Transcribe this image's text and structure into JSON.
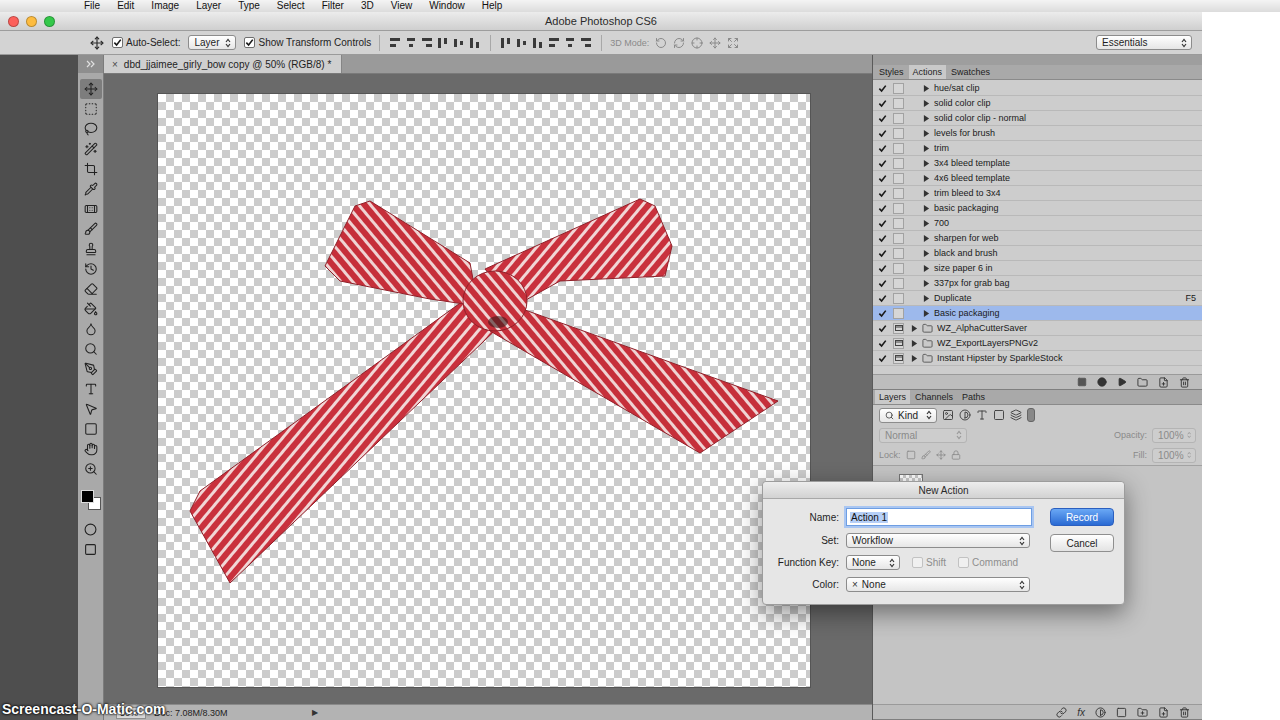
{
  "menu_bar": {
    "items": [
      "File",
      "Edit",
      "Image",
      "Layer",
      "Type",
      "Select",
      "Filter",
      "3D",
      "View",
      "Window",
      "Help"
    ]
  },
  "window": {
    "title": "Adobe Photoshop CS6"
  },
  "options_bar": {
    "auto_select": {
      "label": "Auto-Select:",
      "checked": true
    },
    "auto_select_target": "Layer",
    "transform_controls": {
      "label": "Show Transform Controls",
      "checked": true
    },
    "mode_3d_label": "3D Mode:",
    "workspace": "Essentials"
  },
  "document_tab": {
    "title": "dbd_jjaimee_girly_bow copy @ 50% (RGB/8) *",
    "close": "×",
    "selected": true
  },
  "actions_panel": {
    "tabs": [
      {
        "label": "Styles",
        "selected": false
      },
      {
        "label": "Actions",
        "selected": true
      },
      {
        "label": "Swatches",
        "selected": false
      }
    ],
    "items": [
      {
        "name": "hue/sat clip",
        "kind": "action",
        "enabled": true,
        "dialog": false,
        "expanded": false,
        "selected": false
      },
      {
        "name": "solid color clip",
        "kind": "action",
        "enabled": true,
        "dialog": false,
        "expanded": false,
        "selected": false
      },
      {
        "name": "solid color clip - normal",
        "kind": "action",
        "enabled": true,
        "dialog": false,
        "expanded": false,
        "selected": false
      },
      {
        "name": "levels for brush",
        "kind": "action",
        "enabled": true,
        "dialog": false,
        "expanded": false,
        "selected": false
      },
      {
        "name": "trim",
        "kind": "action",
        "enabled": true,
        "dialog": false,
        "expanded": false,
        "selected": false
      },
      {
        "name": "3x4 bleed template",
        "kind": "action",
        "enabled": true,
        "dialog": false,
        "expanded": false,
        "selected": false
      },
      {
        "name": "4x6 bleed template",
        "kind": "action",
        "enabled": true,
        "dialog": false,
        "expanded": false,
        "selected": false
      },
      {
        "name": "trim bleed to 3x4",
        "kind": "action",
        "enabled": true,
        "dialog": false,
        "expanded": false,
        "selected": false
      },
      {
        "name": "basic packaging",
        "kind": "action",
        "enabled": true,
        "dialog": false,
        "expanded": false,
        "selected": false
      },
      {
        "name": "700",
        "kind": "action",
        "enabled": true,
        "dialog": false,
        "expanded": false,
        "selected": false
      },
      {
        "name": "sharpen for web",
        "kind": "action",
        "enabled": true,
        "dialog": false,
        "expanded": false,
        "selected": false
      },
      {
        "name": "black and brush",
        "kind": "action",
        "enabled": true,
        "dialog": false,
        "expanded": false,
        "selected": false
      },
      {
        "name": "size paper 6 in",
        "kind": "action",
        "enabled": true,
        "dialog": false,
        "expanded": false,
        "selected": false
      },
      {
        "name": "337px for grab bag",
        "kind": "action",
        "enabled": true,
        "dialog": false,
        "expanded": false,
        "selected": false
      },
      {
        "name": "Duplicate",
        "kind": "action",
        "enabled": true,
        "dialog": false,
        "expanded": false,
        "selected": false,
        "shortcut": "F5"
      },
      {
        "name": "Basic packaging",
        "kind": "action",
        "enabled": true,
        "dialog": false,
        "expanded": false,
        "selected": true
      },
      {
        "name": "WZ_AlphaCutterSaver",
        "kind": "set",
        "enabled": true,
        "dialog": true,
        "expanded": false,
        "selected": false
      },
      {
        "name": "WZ_ExportLayersPNGv2",
        "kind": "set",
        "enabled": true,
        "dialog": true,
        "expanded": false,
        "selected": false
      },
      {
        "name": "Instant Hipster by SparkleStock",
        "kind": "set",
        "enabled": true,
        "dialog": true,
        "expanded": false,
        "selected": false
      }
    ]
  },
  "layers_panel": {
    "tabs": [
      {
        "label": "Layers",
        "selected": true
      },
      {
        "label": "Channels",
        "selected": false
      },
      {
        "label": "Paths",
        "selected": false
      }
    ],
    "filter": "Kind",
    "blend_mode": "Normal",
    "opacity_label": "Opacity:",
    "opacity": "100%",
    "lock_label": "Lock:",
    "fill_label": "Fill:",
    "fill": "100%",
    "disabled": true,
    "effects_label": "fx"
  },
  "status_bar": {
    "zoom": "50%",
    "doc": "Doc: 7.08M/8.30M",
    "menu": "▶"
  },
  "dialog": {
    "title": "New Action",
    "name": {
      "label": "Name:",
      "value": "Action 1",
      "selected": true
    },
    "set": {
      "label": "Set:",
      "value": "Workflow"
    },
    "function_key": {
      "label": "Function Key:",
      "value": "None"
    },
    "modifiers": [
      {
        "label": "Shift",
        "checked": false,
        "disabled": true
      },
      {
        "label": "Command",
        "checked": false,
        "disabled": true
      }
    ],
    "color": {
      "label": "Color:",
      "symbol": "×",
      "value": "None"
    },
    "buttons": [
      {
        "label": "Record",
        "default": true
      },
      {
        "label": "Cancel",
        "default": false
      }
    ]
  },
  "watermark": "Screencast-O-Matic.com"
}
